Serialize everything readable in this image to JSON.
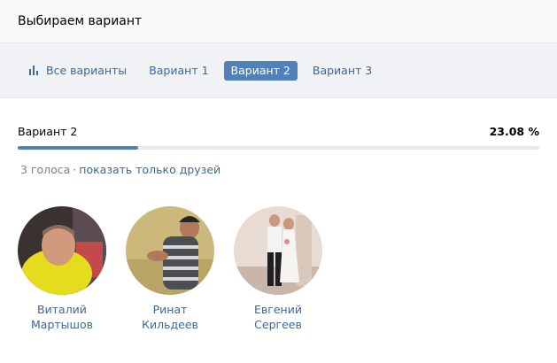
{
  "header": {
    "title": "Выбираем вариант"
  },
  "tabs": {
    "all": "Все варианты",
    "items": [
      "Вариант 1",
      "Вариант 2",
      "Вариант 3"
    ],
    "active_index": 1
  },
  "result": {
    "label": "Вариант 2",
    "percent": "23.08 %",
    "fraction": 0.2308
  },
  "voters": {
    "count": "3 голоса",
    "separator": "·",
    "friends_link": "показать только друзей"
  },
  "users": [
    {
      "first": "Виталий",
      "last": "Мартышов"
    },
    {
      "first": "Ринат",
      "last": "Кильдеев"
    },
    {
      "first": "Евгений",
      "last": "Сергеев"
    }
  ],
  "colors": {
    "accent": "#5181b8",
    "link": "#3d6898",
    "bar_track": "#e7eaee",
    "muted": "#828282"
  }
}
